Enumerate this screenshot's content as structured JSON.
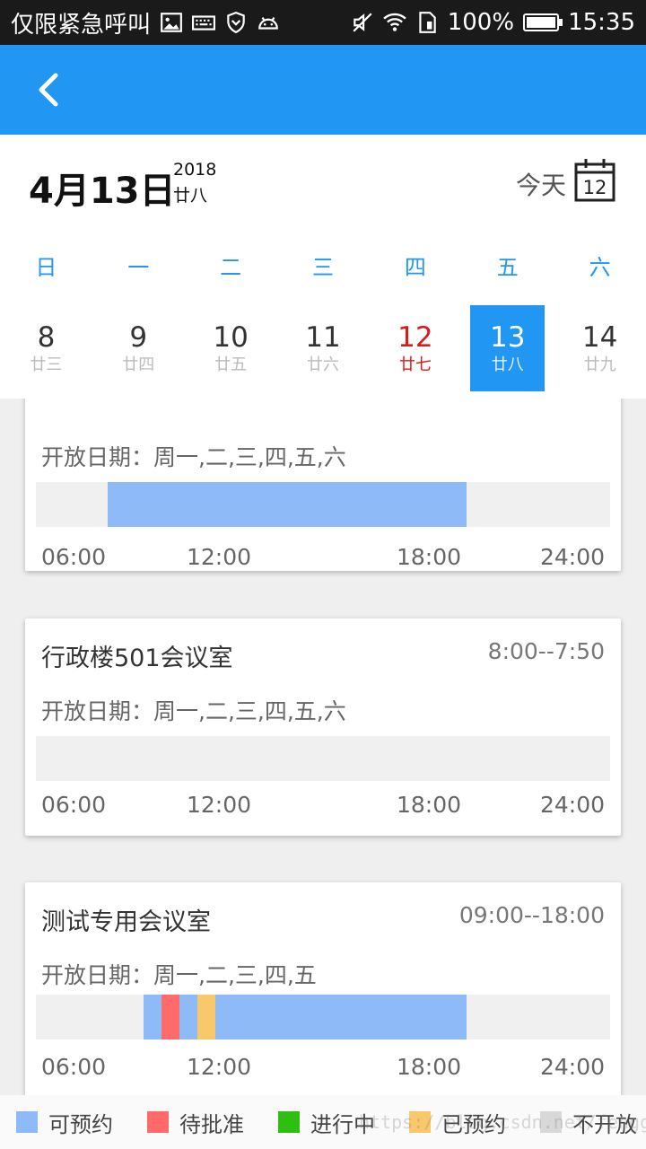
{
  "status_bar": {
    "carrier": "仅限紧急呼叫",
    "battery": "100%",
    "time": "15:35",
    "icons": [
      "image-icon",
      "keyboard-icon",
      "shield-icon",
      "android-icon",
      "mute-icon",
      "wifi-icon",
      "sim-icon",
      "battery-icon"
    ]
  },
  "app_bar": {
    "back_icon": "chevron-left-icon",
    "color": "#2196f3"
  },
  "calendar": {
    "selected_date": "4月13日",
    "year": "2018",
    "lunar": "廿八",
    "today_label": "今天",
    "today_icon_day": "12",
    "weekdays": [
      "日",
      "一",
      "二",
      "三",
      "四",
      "五",
      "六"
    ],
    "days": [
      {
        "num": "8",
        "lunar": "廿三",
        "state": "normal"
      },
      {
        "num": "9",
        "lunar": "廿四",
        "state": "normal"
      },
      {
        "num": "10",
        "lunar": "廿五",
        "state": "normal"
      },
      {
        "num": "11",
        "lunar": "廿六",
        "state": "normal"
      },
      {
        "num": "12",
        "lunar": "廿七",
        "state": "today"
      },
      {
        "num": "13",
        "lunar": "廿八",
        "state": "selected"
      },
      {
        "num": "14",
        "lunar": "廿九",
        "state": "normal"
      }
    ]
  },
  "rooms": [
    {
      "title": "",
      "hours": "",
      "open_days": "开放日期：周一,二,三,四,五,六",
      "segments": [
        {
          "from": 8,
          "to": 18,
          "status": "available"
        }
      ]
    },
    {
      "title": "行政楼501会议室",
      "hours": "8:00--7:50",
      "open_days": "开放日期：周一,二,三,四,五,六",
      "segments": []
    },
    {
      "title": "测试专用会议室",
      "hours": "09:00--18:00",
      "open_days": "开放日期：周一,二,三,四,五",
      "segments": [
        {
          "from": 9,
          "to": 9.5,
          "status": "available"
        },
        {
          "from": 9.5,
          "to": 10,
          "status": "pending"
        },
        {
          "from": 10,
          "to": 10.5,
          "status": "available"
        },
        {
          "from": 10.5,
          "to": 11,
          "status": "booked"
        },
        {
          "from": 11,
          "to": 18,
          "status": "available"
        }
      ]
    }
  ],
  "timeline": {
    "start": 6,
    "end": 22,
    "ticks": [
      "06:00",
      "12:00",
      "18:00",
      "24:00"
    ]
  },
  "legend": [
    {
      "key": "available",
      "label": "可预约",
      "color": "#8fbaf8"
    },
    {
      "key": "pending",
      "label": "待批准",
      "color": "#ff6b6b"
    },
    {
      "key": "in_progress",
      "label": "进行中",
      "color": "#2fbf10"
    },
    {
      "key": "booked",
      "label": "已预约",
      "color": "#f9c86a"
    },
    {
      "key": "closed",
      "label": "不开放",
      "color": "#d8d8d8"
    }
  ],
  "watermark": "https://blog.csdn.net/fengge_fly"
}
